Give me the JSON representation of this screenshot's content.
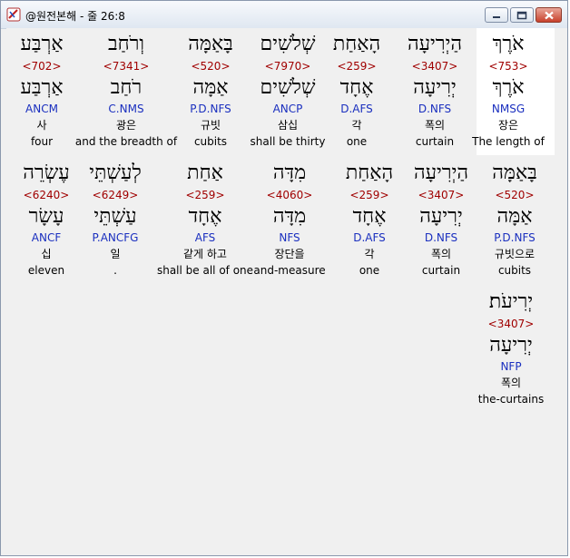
{
  "window": {
    "title": "@원전본해 - 줄 26:8"
  },
  "rows": [
    {
      "words": [
        {
          "heb": "אֹרֶךְ",
          "strong": "<753>",
          "lemma": "אֹרֶךְ",
          "morph": "NMSG",
          "kor": "장은",
          "eng": "The length of",
          "selected": true
        },
        {
          "heb": "הַיְרִיעָה",
          "strong": "<3407>",
          "lemma": "יְרִיעָה",
          "morph": "D.NFS",
          "kor": "폭의",
          "eng": "curtain"
        },
        {
          "heb": "הָאַחַת",
          "strong": "<259>",
          "lemma": "אֶחָד",
          "morph": "D.AFS",
          "kor": "각",
          "eng": "one"
        },
        {
          "heb": "שְׁלֹשִׁים",
          "strong": "<7970>",
          "lemma": "שְׁלֹשִׁים",
          "morph": "ANCP",
          "kor": "삼십",
          "eng": "shall be thirty"
        },
        {
          "heb": "בָּאַמָּה",
          "strong": "<520>",
          "lemma": "אַמָּה",
          "morph": "P.D.NFS",
          "kor": "규빗",
          "eng": "cubits"
        },
        {
          "heb": "וְרֹחַב",
          "strong": "<7341>",
          "lemma": "רֹחַב",
          "morph": "C.NMS",
          "kor": "광은",
          "eng": "and the breadth of"
        },
        {
          "heb": "אַרְבַּע",
          "strong": "<702>",
          "lemma": "אַרְבַּע",
          "morph": "ANCM",
          "kor": "사",
          "eng": "four"
        }
      ]
    },
    {
      "words": [
        {
          "heb": "בָּאַמָּה",
          "strong": "<520>",
          "lemma": "אַמָּה",
          "morph": "P.D.NFS",
          "kor": "규빗으로",
          "eng": "cubits"
        },
        {
          "heb": "הַיְרִיעָה",
          "strong": "<3407>",
          "lemma": "יְרִיעָה",
          "morph": "D.NFS",
          "kor": "폭의",
          "eng": "curtain"
        },
        {
          "heb": "הָאַחַת",
          "strong": "<259>",
          "lemma": "אֶחָד",
          "morph": "D.AFS",
          "kor": "각",
          "eng": "one"
        },
        {
          "heb": "מִדָּה",
          "strong": "<4060>",
          "lemma": "מִדָּה",
          "morph": "NFS",
          "kor": "장단을",
          "eng": "and-measure"
        },
        {
          "heb": "אַחַת",
          "strong": "<259>",
          "lemma": "אֶחָד",
          "morph": "AFS",
          "kor": "같게 하고",
          "eng": "shall be all of one"
        },
        {
          "heb": "לְעַשְׁתֵּי",
          "strong": "<6249>",
          "lemma": "עַשְׁתֵּי",
          "morph": "P.ANCFG",
          "kor": "일",
          "eng": "."
        },
        {
          "heb": "עֶשְׂרֵה",
          "strong": "<6240>",
          "lemma": "עָשָׂר",
          "morph": "ANCF",
          "kor": "십",
          "eng": "eleven"
        }
      ]
    },
    {
      "words": [
        {
          "heb": "יְרִיעֹת׃",
          "strong": "<3407>",
          "lemma": "יְרִיעָה",
          "morph": "NFP",
          "kor": "폭의",
          "eng": "the-curtains"
        }
      ]
    }
  ]
}
